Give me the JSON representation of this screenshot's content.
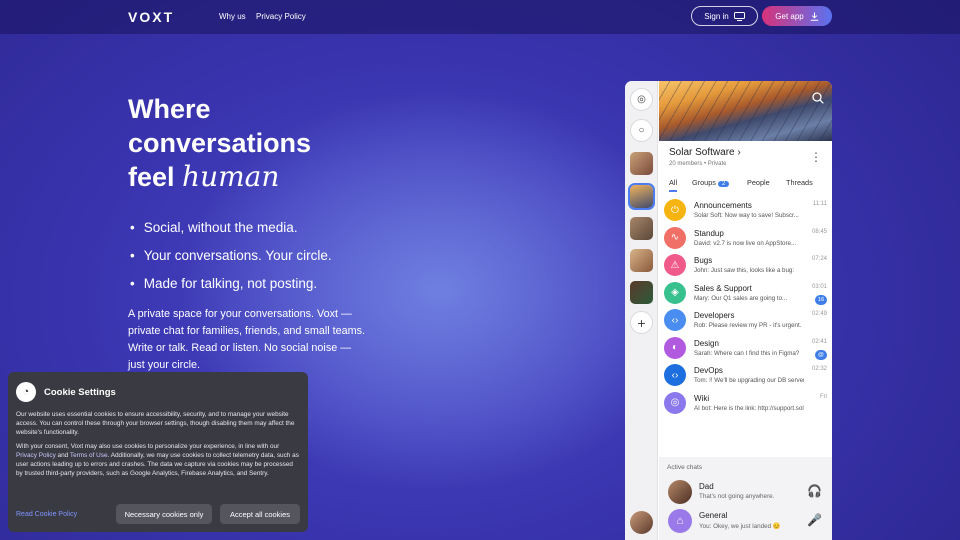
{
  "brand": {
    "logo": "VOXT"
  },
  "nav": {
    "why": "Why us",
    "privacy": "Privacy Policy"
  },
  "header": {
    "signin": "Sign in",
    "getapp": "Get app"
  },
  "hero": {
    "line1": "Where",
    "line2": "conversations",
    "line3a": "feel",
    "line3b": "human"
  },
  "bullets": [
    "Social, without the media.",
    "Your conversations. Your circle.",
    "Made for talking, not posting."
  ],
  "description": "A private space for your conversations. Voxt — private chat for families, friends, and small teams. Write or talk. Read or listen. No social noise — just your circle.",
  "cookie": {
    "title": "Cookie Settings",
    "p1": "Our website uses essential cookies to ensure accessibility, security, and to manage your website access. You can control these through your browser settings, though disabling them may affect the website's functionality.",
    "p2a": "With your consent, Voxt may also use cookies to personalize your experience, in line with our ",
    "p2_pp": "Privacy Policy",
    "p2b": " and ",
    "p2_tou": "Terms of Use",
    "p2c": ". Additionally, we may use cookies to collect telemetry data, such as user actions leading up to errors and crashes. The data we capture via cookies may be processed by trusted third-party providers, such as Google Analytics, Firebase Analytics, and Sentry.",
    "read": "Read Cookie Policy",
    "necessary": "Necessary cookies only",
    "accept": "Accept all cookies"
  },
  "app": {
    "group_title": "Solar Software",
    "group_sub": "20 members • Private",
    "tabs": {
      "all": "All",
      "groups": "Groups",
      "groups_count": "2",
      "people": "People",
      "threads": "Threads"
    },
    "chats": [
      {
        "name": "Announcements",
        "last": "Solar Soft: Now way to save! Subscr...",
        "time": "11:11",
        "badge": "",
        "color": "#f5b40f",
        "icon": "⏻"
      },
      {
        "name": "Standup",
        "last": "David: v2.7 is now live on AppStore...",
        "time": "08:45",
        "badge": "",
        "color": "#f06f66",
        "icon": "∿"
      },
      {
        "name": "Bugs",
        "last": "John: Just saw this, looks like a bug:",
        "time": "07:24",
        "badge": "",
        "color": "#ef5a8a",
        "icon": "⚠"
      },
      {
        "name": "Sales & Support",
        "last": "Mary: Our Q1 sales are going to...",
        "time": "03:01",
        "badge": "16",
        "color": "#38c08f",
        "icon": "◈"
      },
      {
        "name": "Developers",
        "last": "Rob: Please review my PR - it's urgent.",
        "time": "02:49",
        "badge": "",
        "color": "#4a8df0",
        "icon": "‹›"
      },
      {
        "name": "Design",
        "last": "Sarah: Where can I find this in Figma?",
        "time": "02:41",
        "badge": "@",
        "color": "#b15ae0",
        "icon": "◐"
      },
      {
        "name": "DevOps",
        "last": "Tom: !! We'll be upgrading our DB servers...",
        "time": "02:32",
        "badge": "",
        "color": "#1d6fe0",
        "icon": "‹›"
      },
      {
        "name": "Wiki",
        "last": "AI bot: Here is the link: http://support.solars...",
        "time": "Fri",
        "badge": "",
        "color": "#8b78ec",
        "icon": "◎"
      }
    ],
    "active_label": "Active chats",
    "active": [
      {
        "name": "Dad",
        "last": "That's not going anywhere.",
        "icon": "🎧"
      },
      {
        "name": "General",
        "last": "You: Okey, we just landed 😊",
        "icon": "🎤"
      }
    ]
  }
}
